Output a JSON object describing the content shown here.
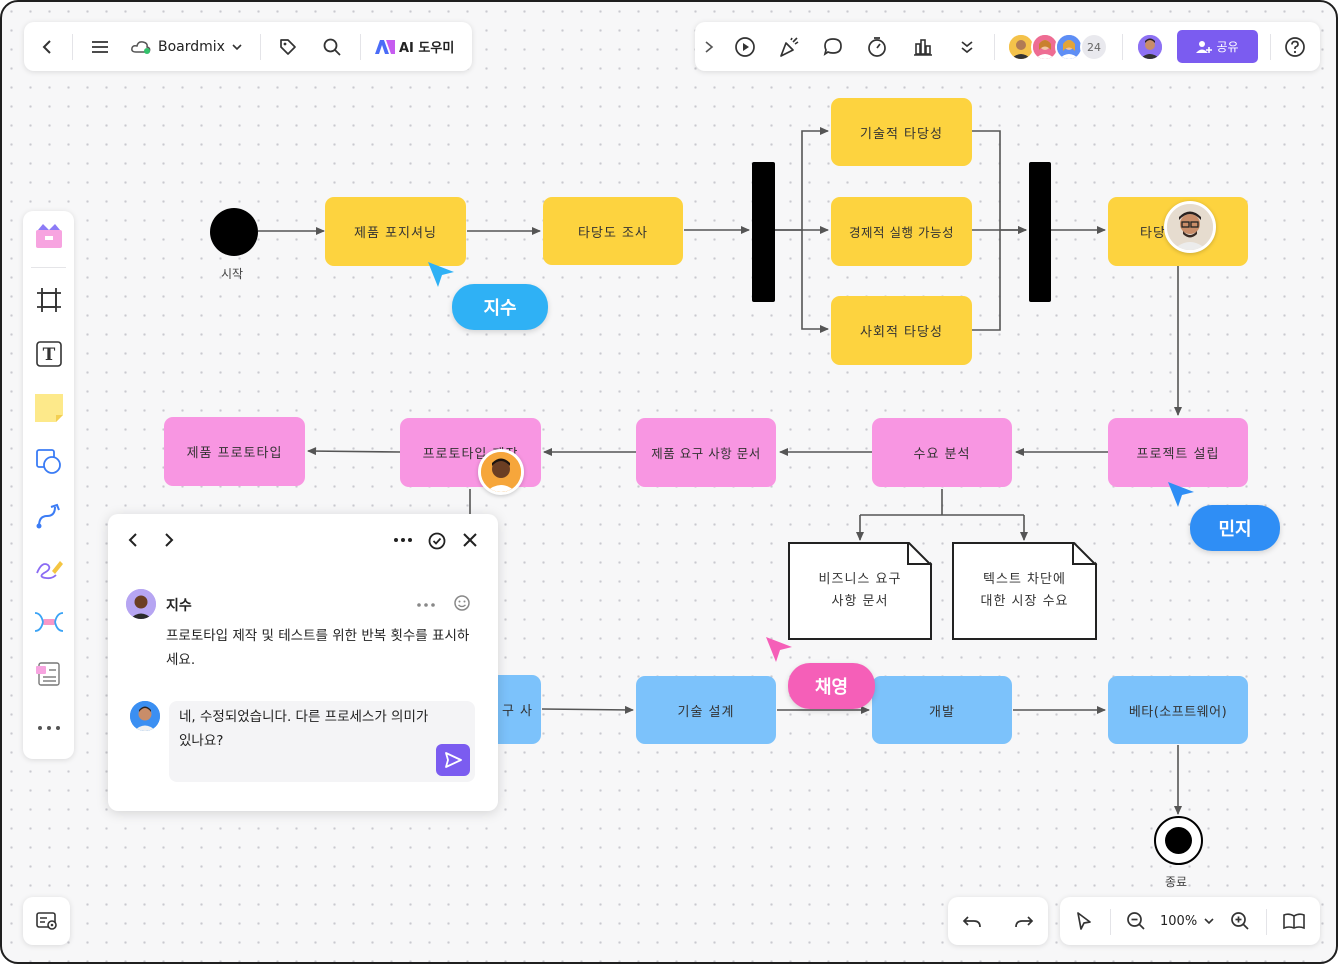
{
  "toolbar": {
    "brand": "Boardmix",
    "ai_label": "AI 도우미",
    "member_count": "24",
    "share_label": "공유"
  },
  "flow": {
    "start": "시작",
    "end": "종료",
    "row1": [
      "제품 포지셔닝",
      "타당도 조사",
      "기술적 타당성",
      "경제적 실행 가능성",
      "사회적 타당성",
      "타당"
    ],
    "row2": [
      "제품 프로토타입",
      "프로토타입 제작",
      "제품 요구 사항 문서",
      "수요 분석",
      "프로젝트 설립"
    ],
    "docs": [
      "비즈니스 요구\n사항 문서",
      "텍스트 차단에\n대한 시장 수요"
    ],
    "row3": [
      "구 사",
      "기술 설계",
      "개발",
      "베타(소프트웨어)"
    ]
  },
  "cursors": {
    "jisu": "지수",
    "minji": "민지",
    "chaeyoung": "채영"
  },
  "comment": {
    "author": "지수",
    "message": "프로토타입 제작 및 테스트를 위한 반복 횟수를 표시하세요.",
    "reply": "네, 수정되었습니다. 다른 프로세스가 의미가 있나요?"
  },
  "zoom": {
    "level": "100%"
  },
  "colors": {
    "accent": "#7b5cf0",
    "yellow": "#fdd33f",
    "pink": "#f896e2",
    "blue": "#7cc2fb",
    "cursor_blue": "#2fb1f5",
    "cursor_pink": "#f55fb8"
  }
}
